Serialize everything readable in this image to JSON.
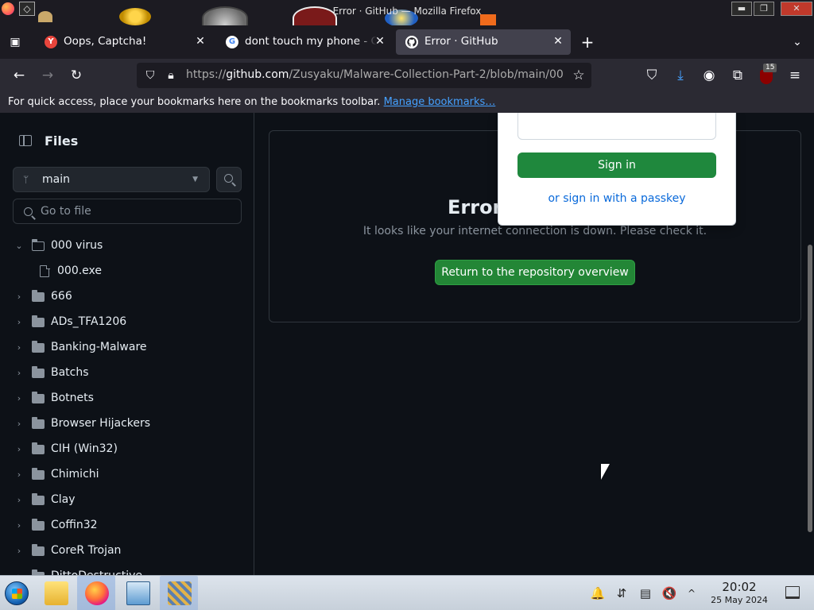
{
  "window": {
    "title": "Error · GitHub — Mozilla Firefox",
    "min_glyph": "▬",
    "max_glyph": "❐",
    "close_glyph": "✕"
  },
  "tabs": [
    {
      "label": "Oops, Captcha!",
      "favicon": "Y",
      "active": false
    },
    {
      "label": "dont touch my phone - Go",
      "favicon": "G",
      "active": false
    },
    {
      "label": "Error · GitHub",
      "favicon": "github-icon",
      "active": true
    }
  ],
  "tab_close_glyph": "✕",
  "newtab_glyph": "+",
  "tabs_overflow_glyph": "⌄",
  "tab_list_glyph": "▣",
  "nav": {
    "back_glyph": "←",
    "forward_glyph": "→",
    "reload_glyph": "↻",
    "url_prefix": "https://",
    "url_host": "github.com",
    "url_path": "/Zusyaku/Malware-Collection-Part-2/blob/main/00",
    "star_glyph": "☆",
    "pocket_glyph": "⛉",
    "download_glyph": "⤓",
    "account_glyph": "◉",
    "extensions_glyph": "⧉",
    "menu_glyph": "≡",
    "ublock_count": "15"
  },
  "bookmarks_bar": {
    "text": "For quick access, place your bookmarks here on the bookmarks toolbar.",
    "link": "Manage bookmarks…"
  },
  "sidebar": {
    "title": "Files",
    "branch": "main",
    "goto_placeholder": "Go to file",
    "tree": [
      {
        "label": "000 virus",
        "type": "folder",
        "expanded": true,
        "depth": 0
      },
      {
        "label": "000.exe",
        "type": "file",
        "depth": 1
      },
      {
        "label": "666",
        "type": "folder",
        "expanded": false,
        "depth": 0
      },
      {
        "label": "ADs_TFA1206",
        "type": "folder",
        "expanded": false,
        "depth": 0
      },
      {
        "label": "Banking-Malware",
        "type": "folder",
        "expanded": false,
        "depth": 0
      },
      {
        "label": "Batchs",
        "type": "folder",
        "expanded": false,
        "depth": 0
      },
      {
        "label": "Botnets",
        "type": "folder",
        "expanded": false,
        "depth": 0
      },
      {
        "label": "Browser Hijackers",
        "type": "folder",
        "expanded": false,
        "depth": 0
      },
      {
        "label": "CIH (Win32)",
        "type": "folder",
        "expanded": false,
        "depth": 0
      },
      {
        "label": "Chimichi",
        "type": "folder",
        "expanded": false,
        "depth": 0
      },
      {
        "label": "Clay",
        "type": "folder",
        "expanded": false,
        "depth": 0
      },
      {
        "label": "Coffin32",
        "type": "folder",
        "expanded": false,
        "depth": 0
      },
      {
        "label": "CoreR Trojan",
        "type": "folder",
        "expanded": false,
        "depth": 0
      },
      {
        "label": "DittoDestructive",
        "type": "folder",
        "expanded": false,
        "depth": 0
      }
    ],
    "chevron_expanded": "⌄",
    "chevron_collapsed": "›",
    "branch_glyph": "ᛘ",
    "caret_glyph": "▼"
  },
  "main": {
    "error_title": "Error",
    "error_message": "It looks like your internet connection is down. Please check it.",
    "return_button": "Return to the repository overview"
  },
  "signin_popover": {
    "signin_button": "Sign in",
    "passkey_link": "or sign in with a passkey"
  },
  "taskbar": {
    "time": "20:02",
    "date": "25 May 2024",
    "tray": {
      "bell_glyph": "🔔",
      "network_glyph": "⇵",
      "clipboard_glyph": "▤",
      "volume_glyph": "🔇",
      "expand_glyph": "^"
    }
  },
  "colors": {
    "accent_green": "#238636",
    "link_blue": "#0969da",
    "page_bg": "#0d1117",
    "browser_chrome": "#1c1b22"
  }
}
